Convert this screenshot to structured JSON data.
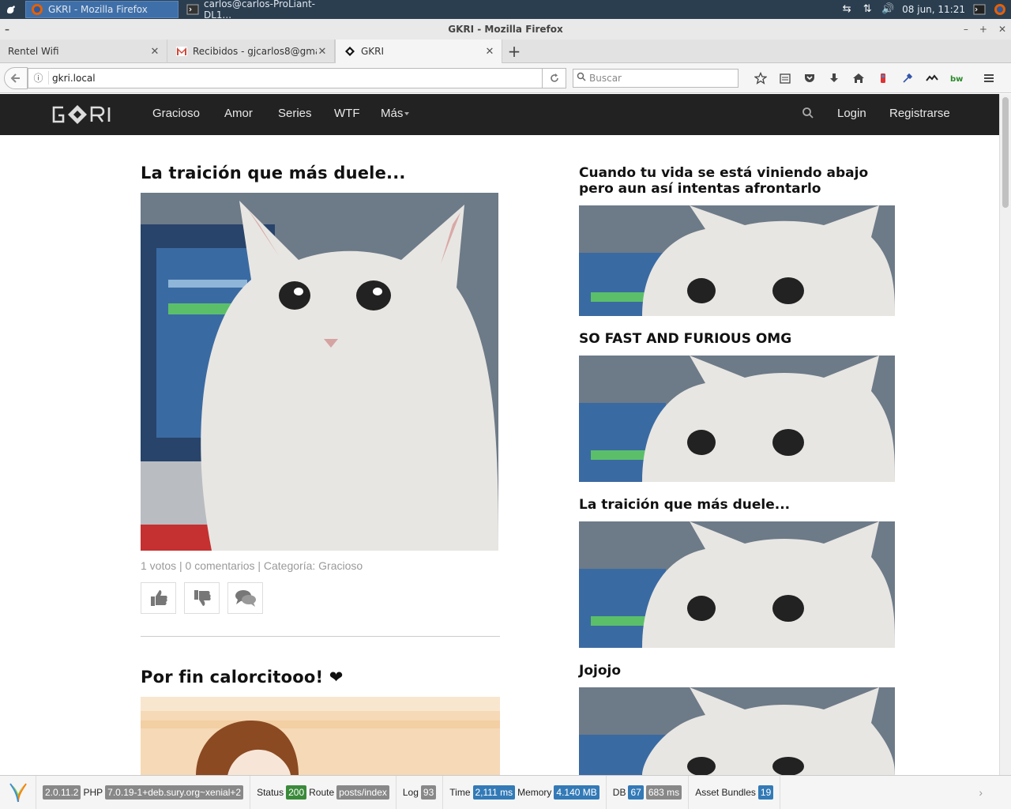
{
  "os_panel": {
    "tasks": [
      {
        "label": "GKRI - Mozilla Firefox",
        "active": true
      },
      {
        "label": "carlos@carlos-ProLiant-DL1...",
        "active": false
      }
    ],
    "clock": "08 jun, 11:21"
  },
  "window": {
    "title": "GKRI - Mozilla Firefox"
  },
  "tabs": [
    {
      "label": "Rentel Wifi",
      "selected": false
    },
    {
      "label": "Recibidos - gjcarlos8@gmai",
      "selected": false
    },
    {
      "label": "GKRI",
      "selected": true
    }
  ],
  "navbar": {
    "url": "gkri.local",
    "search_placeholder": "Buscar"
  },
  "site": {
    "nav": [
      "Gracioso",
      "Amor",
      "Series",
      "WTF",
      "Más"
    ],
    "login": "Login",
    "register": "Registrarse"
  },
  "main_posts": [
    {
      "title": "La traición que más duele...",
      "meta": "1 votos | 0 comentarios | Categoría: Gracioso"
    },
    {
      "title": "Por fin calorcitooo! ❤"
    }
  ],
  "sidebar_posts": [
    {
      "title": "Cuando tu vida se está viniendo abajo pero aun así intentas afrontarlo"
    },
    {
      "title": "SO FAST AND FURIOUS OMG"
    },
    {
      "title": "La traición que más duele..."
    },
    {
      "title": "Jojojo"
    }
  ],
  "debug": {
    "yii_version": "2.0.11.2",
    "php_label": "PHP",
    "php_version": "7.0.19-1+deb.sury.org~xenial+2",
    "status_label": "Status",
    "status": "200",
    "route_label": "Route",
    "route": "posts/index",
    "log_label": "Log",
    "log": "93",
    "time_label": "Time",
    "time": "2,111 ms",
    "memory_label": "Memory",
    "memory": "4.140 MB",
    "db_label": "DB",
    "db_queries": "67",
    "db_time": "683 ms",
    "assets_label": "Asset Bundles",
    "assets": "19"
  }
}
